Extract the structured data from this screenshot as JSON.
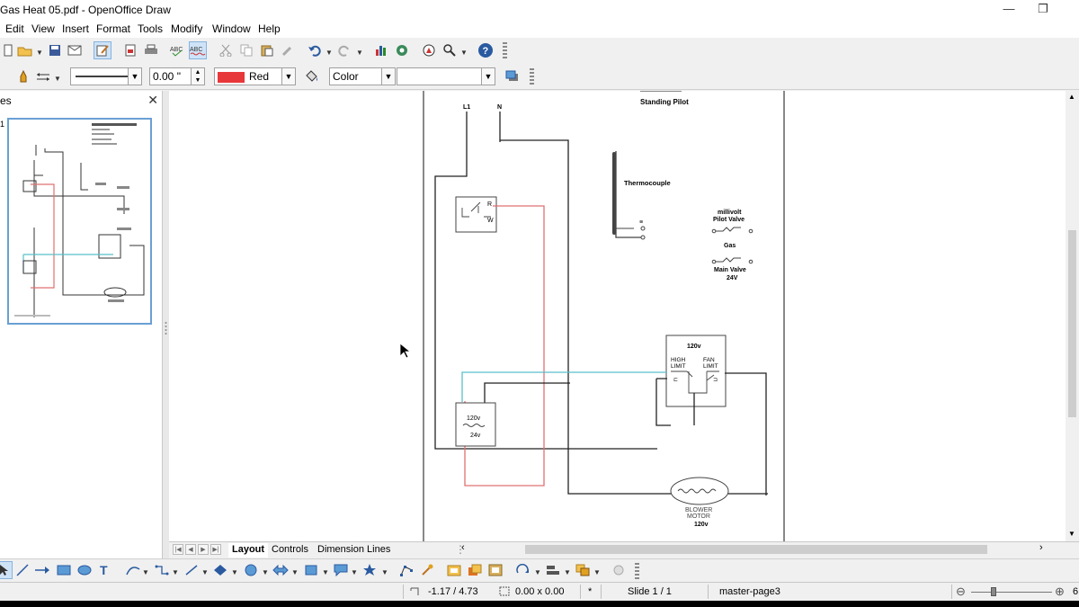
{
  "window": {
    "title": "Gas Heat 05.pdf - OpenOffice Draw",
    "minimize_glyph": "—",
    "restore_glyph": "❐"
  },
  "menu": [
    "Edit",
    "View",
    "Insert",
    "Format",
    "Tools",
    "Modify",
    "Window",
    "Help"
  ],
  "toolbar2": {
    "line_width": "0.00 \"",
    "line_color": "Red",
    "line_color_hex": "#e8373a",
    "area_style": "Color",
    "area_value": ""
  },
  "slides_panel": {
    "title": "es",
    "slide_number": "1"
  },
  "drawing": {
    "header": "Standing Pilot",
    "l1": "L1",
    "n": "N",
    "thermocouple": "Thermocouple",
    "pilot_valve_line1": "millivolt",
    "pilot_valve_line2": "Pilot Valve",
    "gas": "Gas",
    "main_valve": "Main Valve",
    "main_valve_volt": "24V",
    "control_volt": "120v",
    "high_limit_1": "HIGH",
    "high_limit_2": "LIMIT",
    "fan_limit_1": "FAN",
    "fan_limit_2": "LIMIT",
    "transformer_primary": "120v",
    "transformer_secondary": "24v",
    "motor_line1": "BLOWER",
    "motor_line2": "MOTOR",
    "motor_volt": "120v"
  },
  "tabs": [
    "Layout",
    "Controls",
    "Dimension Lines"
  ],
  "status": {
    "position": "-1.17 / 4.73",
    "size": "0.00 x 0.00",
    "modified": "*",
    "slide": "Slide 1 / 1",
    "master": "master-page3",
    "zoom_edge": "6"
  },
  "colors": {
    "wire_red": "#e07070",
    "wire_cyan": "#5bbfc9",
    "wire_dark": "#222222",
    "wire_grey": "#7a8aa0",
    "selection_blue": "#6a9fd4"
  }
}
